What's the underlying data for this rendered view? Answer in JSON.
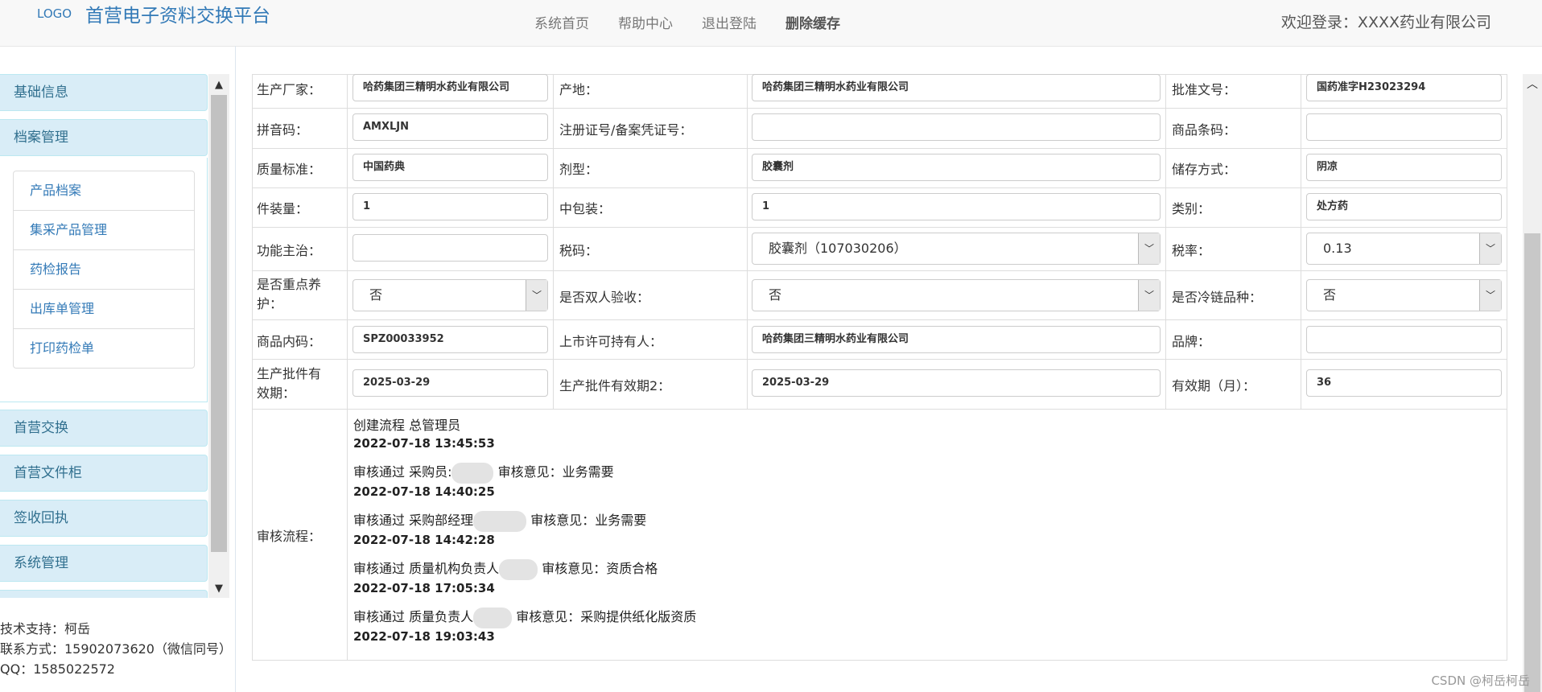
{
  "header": {
    "logo": "LOGO",
    "brand": "首营电子资料交换平台",
    "nav": [
      "系统首页",
      "帮助中心",
      "退出登陆",
      "删除缓存"
    ],
    "welcome": "欢迎登录：XXXX药业有限公司"
  },
  "sidebar": {
    "basic": "基础信息",
    "archive": "档案管理",
    "sub": [
      "产品档案",
      "集采产品管理",
      "药检报告",
      "出库单管理",
      "打印药检单"
    ],
    "exchange": "首营交换",
    "cabinet": "首营文件柜",
    "receipt": "签收回执",
    "system": "系统管理"
  },
  "footer": {
    "support": "技术支持：柯岳",
    "contact": "联系方式：15902073620（微信同号）",
    "qq": "QQ：1585022572"
  },
  "form": {
    "manufacturer_label": "生产厂家：",
    "manufacturer": "哈药集团三精明水药业有限公司",
    "origin_label": "产地：",
    "origin": "哈药集团三精明水药业有限公司",
    "approval_label": "批准文号：",
    "approval": "国药准字H23023294",
    "pinyin_label": "拼音码：",
    "pinyin": "AMXLJN",
    "regno_label": "注册证号/备案凭证号：",
    "regno": "",
    "barcode_label": "商品条码：",
    "barcode": "",
    "quality_label": "质量标准：",
    "quality": "中国药典",
    "dosage_label": "剂型：",
    "dosage": "胶囊剂",
    "storage_label": "储存方式：",
    "storage": "阴凉",
    "pack_label": "件装量：",
    "pack": "1",
    "midpack_label": "中包装：",
    "midpack": "1",
    "category_label": "类别：",
    "category": "处方药",
    "indication_label": "功能主治：",
    "indication": "",
    "taxcode_label": "税码：",
    "taxcode": "胶囊剂（107030206）",
    "taxrate_label": "税率：",
    "taxrate": "0.13",
    "keycare_label_1": "是否重点养",
    "keycare_label_2": "护：",
    "keycare": "否",
    "double_label": "是否双人验收：",
    "double": "否",
    "cold_label": "是否冷链品种：",
    "cold": "否",
    "code_label": "商品内码：",
    "code": "SPZ00033952",
    "holder_label": "上市许可持有人：",
    "holder": "哈药集团三精明水药业有限公司",
    "brand_label": "品牌：",
    "brand": "",
    "valid_label_1": "生产批件有",
    "valid_label_2": "效期：",
    "valid": "2025-03-29",
    "valid2_label": "生产批件有效期2：",
    "valid2": "2025-03-29",
    "period_label": "有效期（月）：",
    "period": "36"
  },
  "flow": {
    "label": "审核流程：",
    "steps": [
      {
        "text_a": "创建流程  总管理员",
        "text_b": "",
        "date": "2022-07-18 13:45:53"
      },
      {
        "text_a": "审核通过  采购员:",
        "text_b": "审核意见：业务需要",
        "date": "2022-07-18 14:40:25"
      },
      {
        "text_a": "审核通过  采购部经理",
        "text_b": "审核意见：业务需要",
        "date": "2022-07-18 14:42:28"
      },
      {
        "text_a": "审核通过  质量机构负责人",
        "text_b": "审核意见：资质合格",
        "date": "2022-07-18 17:05:34"
      },
      {
        "text_a": "审核通过  质量负责人",
        "text_b": "审核意见：采购提供纸化版资质",
        "date": "2022-07-18 19:03:43"
      }
    ]
  },
  "watermark": "CSDN @柯岳柯岳"
}
